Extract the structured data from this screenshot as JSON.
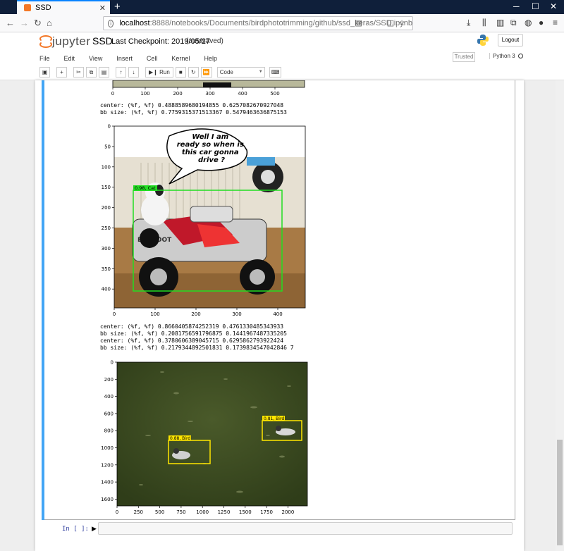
{
  "browser": {
    "tab_title": "SSD",
    "url_host": "localhost",
    "url_path": ":8888/notebooks/Documents/birdphototrimming/github/ssd_keras/SSD.ipynb"
  },
  "jupyter": {
    "logo_text": "jupyter",
    "notebook_name": "SSD",
    "checkpoint": "Last Checkpoint: 2019/05/27",
    "autosaved": "(autosaved)",
    "logout_label": "Logout",
    "menu": [
      "File",
      "Edit",
      "View",
      "Insert",
      "Cell",
      "Kernel",
      "Help"
    ],
    "trusted": "Trusted",
    "kernel_name": "Python 3",
    "run_label": "Run",
    "cell_type": "Code"
  },
  "outputs": {
    "text1": "center: (%f, %f) 0.4888589680194855 0.6257082670927048\nbb size: (%f, %f) 0.7759315371513367 0.5479463636875153",
    "text2": "center: (%f, %f) 0.8660405874252319 0.4761330485343933\nbb size: (%f, %f) 0.2081756591796875 0.1441967487335205\ncenter: (%f, %f) 0.3780606389045715 0.6295862793922424\nbb size: (%f, %f) 0.2179344892501831 0.1739834547042846 7"
  },
  "plot0": {
    "x_ticks": [
      "0",
      "100",
      "200",
      "300",
      "400",
      "500"
    ]
  },
  "plot1": {
    "y_ticks": [
      "0",
      "50",
      "100",
      "150",
      "200",
      "250",
      "300",
      "350",
      "400"
    ],
    "x_ticks": [
      "0",
      "100",
      "200",
      "300",
      "400"
    ],
    "speech": [
      "Well I am",
      "ready so when is",
      "this car gonna",
      "drive ?"
    ],
    "detection_label": "0.98, Cat"
  },
  "plot2": {
    "y_ticks": [
      "0",
      "200",
      "400",
      "600",
      "800",
      "1000",
      "1200",
      "1400",
      "1600"
    ],
    "x_ticks": [
      "0",
      "250",
      "500",
      "750",
      "1000",
      "1250",
      "1500",
      "1750",
      "2000"
    ],
    "detection_label_1": "0.88, Bird",
    "detection_label_2": "0.81, Bird"
  },
  "prompt": "In [ ]:",
  "colors": {
    "accent": "#42a5f5",
    "detect_cat": "#22dd22",
    "detect_bird": "#ffe600"
  }
}
